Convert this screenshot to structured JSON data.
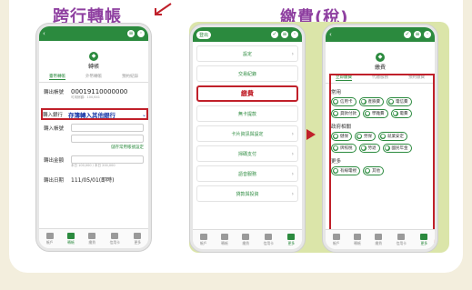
{
  "headings": {
    "transfer": "跨行轉帳",
    "pay": "繳費(稅)"
  },
  "screen1": {
    "title": "轉帳",
    "tabs": [
      "臺幣轉帳",
      "外幣轉帳",
      "預約紀錄"
    ],
    "from_label": "轉出帳號",
    "from_value": "00019110000000",
    "from_hint": "可用餘額：100,641",
    "bank_label": "轉入銀行",
    "bank_value": "存簿轉入其他銀行",
    "to_label": "轉入帳號",
    "link": "儲存常用帳號設定",
    "amount_label": "轉出金額",
    "amount_hint": "本日 100,000 / 本日 200,000",
    "date_label": "轉出日期",
    "date_value": "111/05/01(即時)"
  },
  "screen2": {
    "top_pill": "登出",
    "items": [
      "設定",
      "交易紀錄",
      "繳費",
      "無卡提款",
      "卡片資訊與設定",
      "掃碼支付",
      "語音服務",
      "貸款與投資"
    ]
  },
  "screen3": {
    "title": "繳費",
    "tabs": [
      "立即繳費",
      "代繳服務",
      "預約繳費"
    ],
    "sections": [
      {
        "title": "常用",
        "chips": [
          "信用卡",
          "產險費",
          "電信費",
          "貸款付款",
          "學雜費",
          "電費"
        ]
      },
      {
        "title": "政府相關",
        "chips": [
          "健保",
          "勞保",
          "就業安定",
          "牌照稅",
          "勞退",
          "國民年金"
        ]
      },
      {
        "title": "更多",
        "chips": [
          "有線電視",
          "其他"
        ]
      }
    ]
  },
  "nav": [
    "帳戶",
    "轉帳",
    "繳費",
    "信用卡",
    "更多"
  ]
}
